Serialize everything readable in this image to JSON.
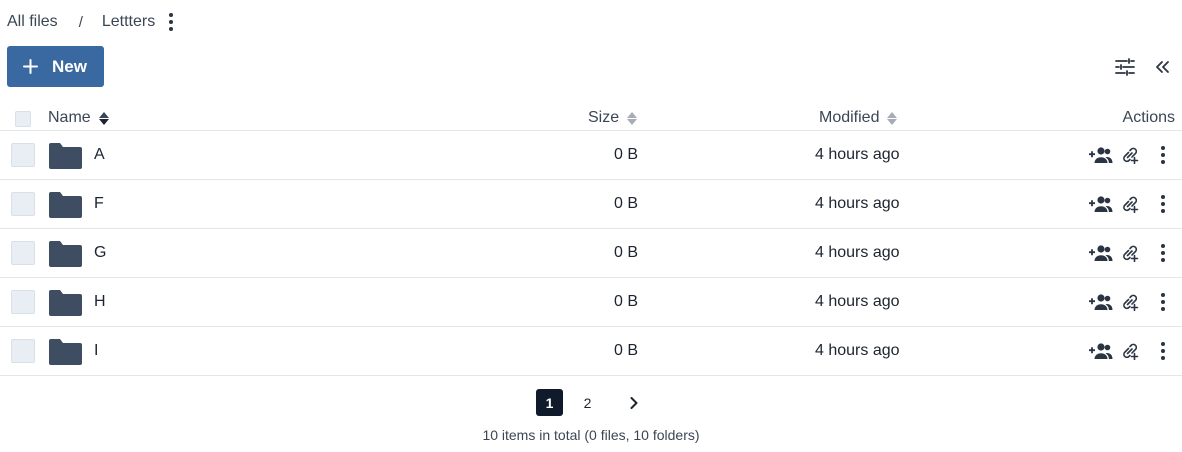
{
  "breadcrumb": {
    "root": "All files",
    "separator": "/",
    "current": "Lettters"
  },
  "toolbar": {
    "new_label": "New",
    "icons": [
      "plus-icon",
      "filter-settings-icon",
      "collapse-double-chevron-icon"
    ]
  },
  "table": {
    "columns": {
      "name": "Name",
      "size": "Size",
      "modified": "Modified",
      "actions": "Actions"
    },
    "sort": {
      "column": "Name",
      "direction": "descending"
    },
    "rows": [
      {
        "name": "A",
        "size": "0 B",
        "modified": "4 hours ago"
      },
      {
        "name": "F",
        "size": "0 B",
        "modified": "4 hours ago"
      },
      {
        "name": "G",
        "size": "0 B",
        "modified": "4 hours ago"
      },
      {
        "name": "H",
        "size": "0 B",
        "modified": "4 hours ago"
      },
      {
        "name": "I",
        "size": "0 B",
        "modified": "4 hours ago"
      }
    ],
    "row_icons": [
      "folder-icon",
      "share-users-icon",
      "add-link-icon",
      "more-vertical-icon"
    ]
  },
  "pagination": {
    "pages": [
      "1",
      "2"
    ],
    "current": "1",
    "summary": "10 items in total (0 files, 10 folders)"
  },
  "colors": {
    "primary": "#3a68a0",
    "folder": "#3e4d62",
    "active_page": "#0f1b2b"
  }
}
